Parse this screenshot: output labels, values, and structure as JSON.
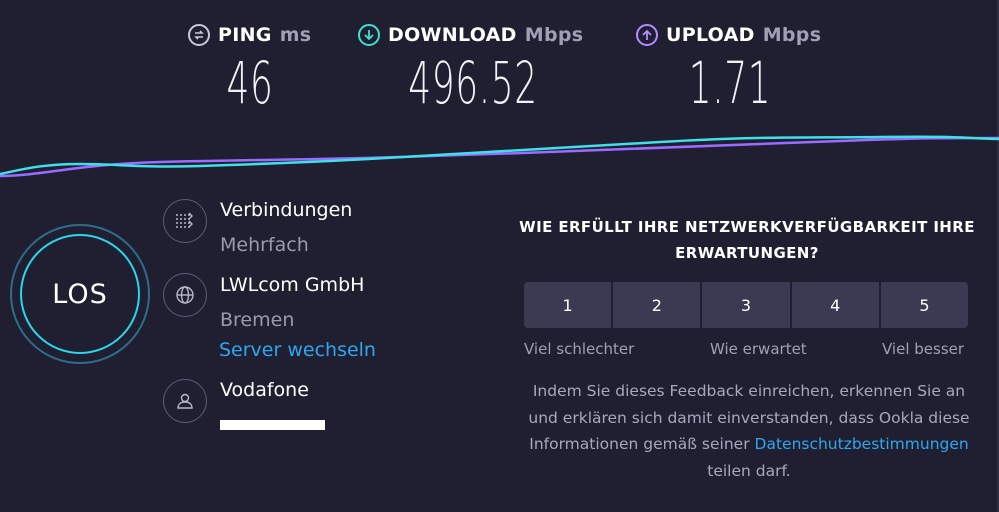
{
  "metrics": {
    "ping": {
      "label": "PING",
      "unit": "ms",
      "value": "46",
      "icon": "ping-icon",
      "color": "#c8c8d8"
    },
    "download": {
      "label": "DOWNLOAD",
      "unit": "Mbps",
      "value": "496.52",
      "icon": "download-arrow-icon",
      "color": "#3fe0d0"
    },
    "upload": {
      "label": "UPLOAD",
      "unit": "Mbps",
      "value": "1.71",
      "icon": "upload-arrow-icon",
      "color": "#b48cff"
    }
  },
  "graph": {
    "download_color": "#3fe0e8",
    "upload_color": "#9a6cff"
  },
  "start_button": {
    "label": "LOS",
    "ring_color": "#2bd6e8"
  },
  "connections": {
    "title": "Verbindungen",
    "value": "Mehrfach",
    "icon": "connections-icon"
  },
  "server": {
    "name": "LWLcom GmbH",
    "location": "Bremen",
    "change_link": "Server wechseln",
    "icon": "globe-icon"
  },
  "provider": {
    "name": "Vodafone",
    "icon": "user-icon"
  },
  "feedback": {
    "question": "WIE ERFÜLLT IHRE NETZWERKVERFÜGBARKEIT IHRE ERWARTUNGEN?",
    "ratings": [
      "1",
      "2",
      "3",
      "4",
      "5"
    ],
    "scale_low": "Viel schlechter",
    "scale_mid": "Wie erwartet",
    "scale_high": "Viel besser",
    "consent_text": "Indem Sie dieses Feedback einreichen, erkennen Sie an und erklären sich damit einverstanden, dass Ookla diese Informationen gemäß seiner",
    "privacy_link": "Datenschutzbestimmungen",
    "consent_tail": "teilen darf."
  },
  "colors": {
    "background": "#1f1f31",
    "link": "#2fa7ee",
    "muted": "#9a9aae"
  }
}
